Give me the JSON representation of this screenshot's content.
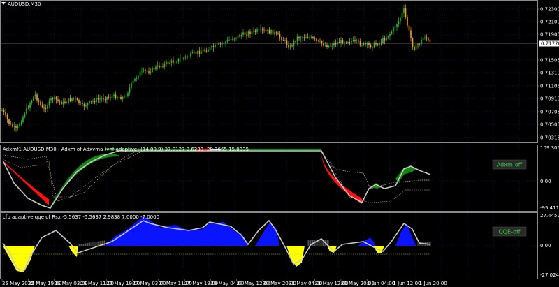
{
  "symbol_label": "AUDUSD,M30",
  "colors": {
    "background": "#000000",
    "grid": "#1f1f6e",
    "border": "#8a8a8a",
    "text": "#ffffff",
    "bull_candle": "#2db82d",
    "bear_candle": "#f0a020",
    "price_line": "#c0c0c0",
    "adxm_green": "#118811",
    "adxm_red": "#ff1010",
    "adxm_line": "#c8c8c8",
    "qqe_blue": "#0a14ff",
    "qqe_yellow": "#ffff00",
    "button_bg": "#2a2a2a",
    "button_text": "#30d030"
  },
  "price_axis": {
    "ticks": [
      "0.72300",
      "0.72100",
      "0.71905",
      "0.71776",
      "0.71505",
      "0.71310",
      "0.71105",
      "0.70910",
      "0.70705",
      "0.70505",
      "0.70315"
    ],
    "current": "0.71776"
  },
  "panel_adxm": {
    "title": "Adxmf1 AUDUSD M30 - Adxm of Adxvma (vhf adaptive) (14.00,9) 37.0127 3.6233 -29.7665 15.0335",
    "ticks": [
      "109.3052",
      "0.00",
      "-95.4114"
    ],
    "button_label": "Adxm-off"
  },
  "panel_qqe": {
    "title": "cfb adaptive qqe of Rsx -5.5637 -5.5637 2.9838 7.0000 -7.0000",
    "ticks": [
      "27.4452",
      "0.00",
      "-27.0243"
    ],
    "button_label": "QQE-off"
  },
  "time_axis": [
    "25 May 2022",
    "25 May 19:00",
    "26 May 03:00",
    "26 May 11:00",
    "26 May 19:00",
    "27 May 03:00",
    "27 May 11:00",
    "27 May 19:00",
    "30 May 04:00",
    "30 May 12:00",
    "30 May 20:00",
    "31 May 04:00",
    "31 May 12:00",
    "31 May 20:00",
    "1 Jun 04:00",
    "1 Jun 12:00",
    "1 Jun 20:00"
  ]
}
